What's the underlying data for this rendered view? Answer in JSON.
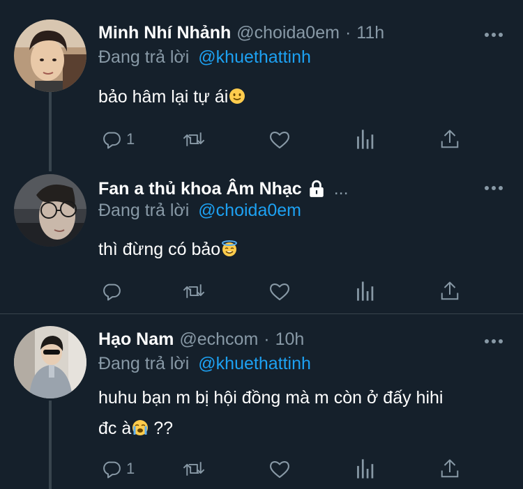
{
  "colors": {
    "background": "#15202b",
    "secondary_text": "#8899a6",
    "link": "#1da1f2",
    "divider": "#38444d"
  },
  "tweets": [
    {
      "name": "Minh Nhí Nhảnh",
      "handle": "@choida0em",
      "dot": "·",
      "time": "11h",
      "reply_label": "Đang trả lời",
      "reply_to": "@khuethattinh",
      "text": "bảo hâm lại tự ái",
      "emoji": "slightly-smiling-face",
      "reply_count": "1",
      "avatar": "avatar-photo"
    },
    {
      "name": "Fan a thủ khoa Âm Nhạc",
      "lock_icon": "lock-icon",
      "ellipsis": "...",
      "reply_label": "Đang trả lời",
      "reply_to": "@choida0em",
      "text": "thì đừng có bảo",
      "emoji": "smiling-face-with-halo",
      "reply_count": "",
      "avatar": "avatar-photo"
    },
    {
      "name": "Hạo Nam",
      "handle": "@echcom",
      "dot": "·",
      "time": "10h",
      "reply_label": "Đang trả lời",
      "reply_to": "@khuethattinh",
      "text_line1": "huhu bạn m bị hội đồng mà m còn ở đấy hihi",
      "text_line2_a": "đc à",
      "text_line2_b": " ??",
      "emoji": "loudly-crying-face",
      "reply_count": "1",
      "avatar": "avatar-photo"
    }
  ],
  "action_icons": [
    "reply-icon",
    "retweet-icon",
    "like-icon",
    "analytics-icon",
    "share-icon"
  ]
}
